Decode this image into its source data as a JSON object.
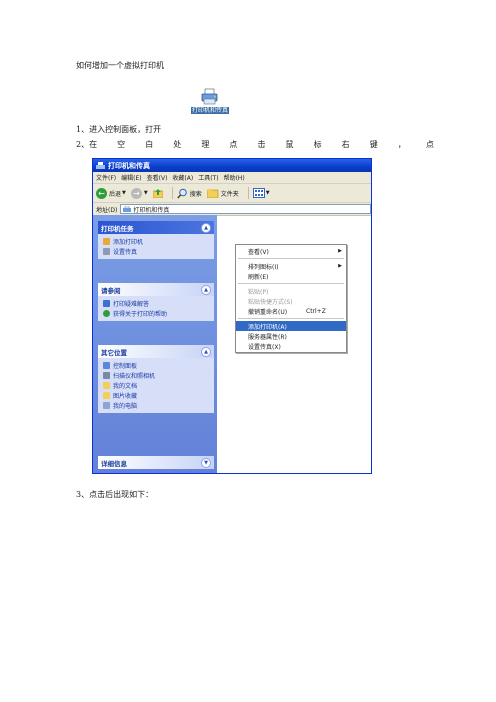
{
  "doc": {
    "title": "如何增加一个虚拟打印机",
    "step1": "1、进入控制面板，打开",
    "step2_chars": [
      "2、在",
      "空",
      "白",
      "处",
      "理",
      "点",
      "击",
      "鼠",
      "标",
      "右",
      "键",
      "，",
      "点"
    ],
    "step3": "3、点击后出现如下："
  },
  "desktop_icon": {
    "label": "打印机和传真",
    "icon": "printer-icon"
  },
  "window": {
    "title": "打印机和传真",
    "menu": [
      "文件(F)",
      "编辑(E)",
      "查看(V)",
      "收藏(A)",
      "工具(T)",
      "帮助(H)"
    ],
    "toolbar": {
      "back": "后退",
      "search": "搜索",
      "folders": "文件夹"
    },
    "address": {
      "label": "地址(D)",
      "value": "打印机和传真"
    },
    "panels": {
      "tasks": {
        "title": "打印机任务",
        "items": [
          "添加打印机",
          "设置传真"
        ]
      },
      "see_also": {
        "title": "请参阅",
        "items": [
          "打印疑难解答",
          "获得关于打印的帮助"
        ]
      },
      "other": {
        "title": "其它位置",
        "items": [
          "控制面板",
          "扫描仪和照相机",
          "我的文档",
          "图片收藏",
          "我的电脑"
        ]
      },
      "details": {
        "title": "详细信息"
      }
    },
    "context_menu": {
      "view": "查看(V)",
      "arrange": "排列图标(I)",
      "refresh": "刷新(E)",
      "paste": "粘贴(P)",
      "paste_shortcut": "粘贴快捷方式(S)",
      "undo_rename": "撤销重命名(U)",
      "undo_shortcut": "Ctrl+Z",
      "add_printer": "添加打印机(A)",
      "server_props": "服务器属性(R)",
      "setup_fax": "设置传真(X)"
    }
  },
  "colors": {
    "xp_blue": "#0a3fcd",
    "panel_bg": "#d6dff7",
    "highlight": "#316ac5"
  }
}
